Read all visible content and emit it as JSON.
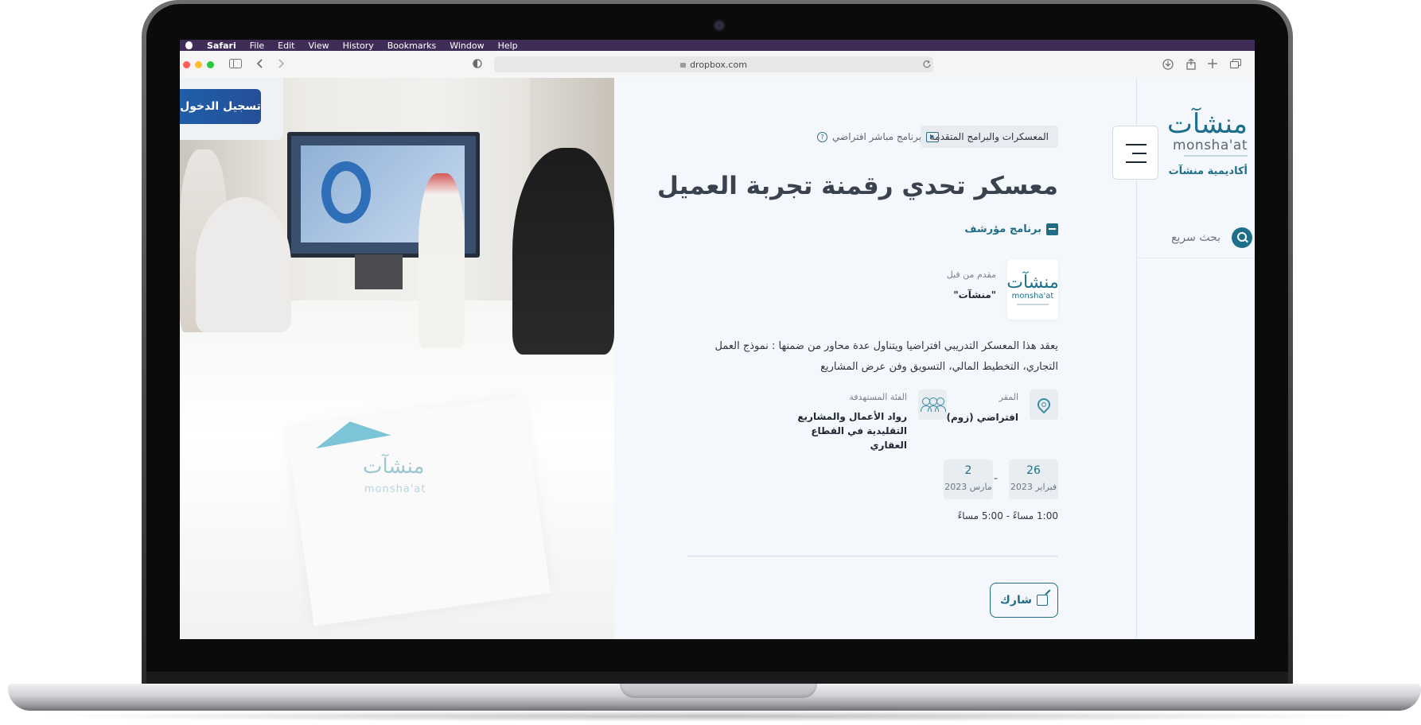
{
  "menubar": {
    "items": [
      "Safari",
      "File",
      "Edit",
      "View",
      "History",
      "Bookmarks",
      "Window",
      "Help"
    ]
  },
  "browser": {
    "url": "dropbox.com"
  },
  "login_button": "تسجيل الدخول",
  "program": {
    "category": "المعسكرات والبرامج المتقدمة",
    "mode": "برنامج مباشر افتراضي",
    "title": "معسكر تحدي رقمنة تجربة العميل",
    "archived_label": "برنامج مؤرشف",
    "provided_by_label": "مقدم من قبل",
    "provider_name": "\"منشآت\"",
    "provider_logo_ar": "منشآت",
    "provider_logo_latin": "monsha'at",
    "description": "يعقد هذا المعسكر التدريبي افتراضيا ويتناول عدة محاور من ضمنها : نموذج العمل التجاري، التخطيط المالي، التسويق وفن عرض المشاريع",
    "location_label": "المقر",
    "location_value": "افتراضي (زوم)",
    "audience_label": "الفئة المستهدفة",
    "audience_value": "رواد الأعمال والمشاريع التقليدية في القطاع العقاري",
    "start_day": "26",
    "start_month": "فبراير 2023",
    "date_separator": "-",
    "end_day": "2",
    "end_month": "مارس 2023",
    "time": "1:00 مساءً - 5:00 مساءً",
    "share_label": "شارك"
  },
  "photo": {
    "logo_ar": "منشآت",
    "logo_latin": "monsha'at"
  },
  "sidebar": {
    "logo_ar": "منشآت",
    "logo_latin": "monsha'at",
    "brand_name": "أكاديمية منشآت",
    "search_label": "بحث سريع"
  },
  "colors": {
    "menubar": "#3f2d57",
    "primary": "#1e6f8a",
    "login": "#1f5ea8",
    "traffic_red": "#fe5f57",
    "traffic_yellow": "#febc2e",
    "traffic_green": "#28c840"
  }
}
